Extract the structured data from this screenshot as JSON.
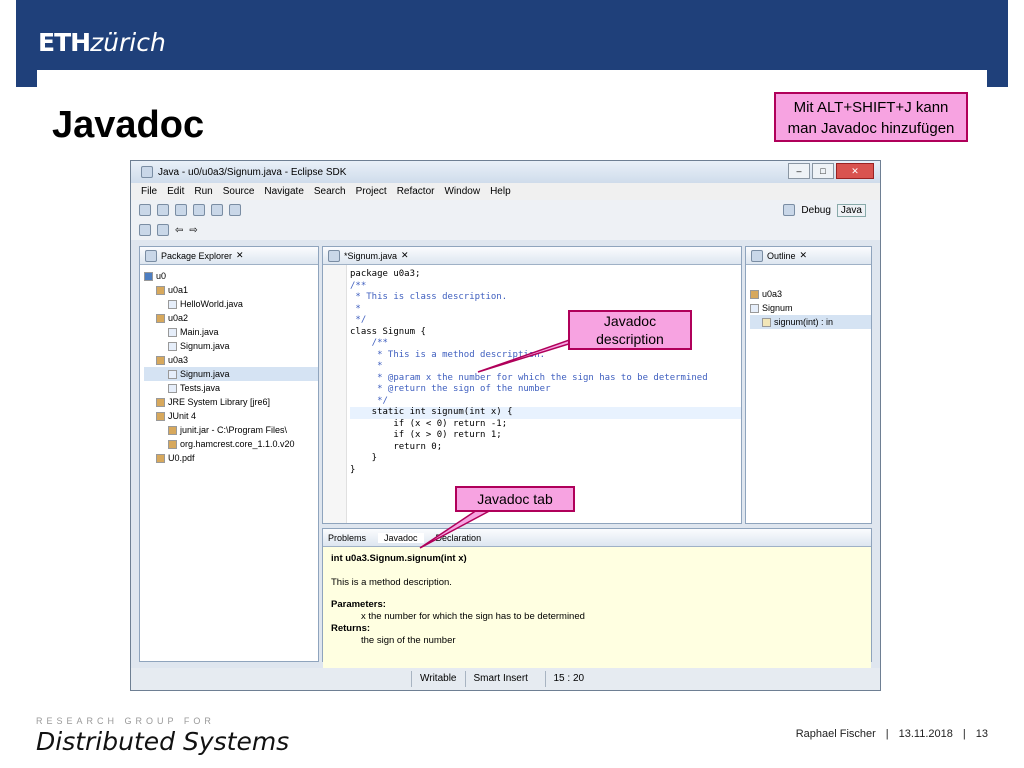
{
  "header": {
    "logo_bold": "ETH",
    "logo_italic": "zürich"
  },
  "slide": {
    "title": "Javadoc",
    "note_line1": "Mit ALT+SHIFT+J kann",
    "note_line2": "man Javadoc hinzufügen"
  },
  "window": {
    "title": "Java - u0/u0a3/Signum.java - Eclipse SDK",
    "buttons": [
      "–",
      "□",
      "✕"
    ]
  },
  "menu": [
    "File",
    "Edit",
    "Run",
    "Source",
    "Navigate",
    "Search",
    "Project",
    "Refactor",
    "Window",
    "Help"
  ],
  "toolbar": {
    "debug": "Debug",
    "java": "Java"
  },
  "explorer": {
    "tab": "Package Explorer",
    "items": [
      {
        "label": "u0",
        "indent": 0
      },
      {
        "label": "u0a1",
        "indent": 1
      },
      {
        "label": "HelloWorld.java",
        "indent": 2
      },
      {
        "label": "u0a2",
        "indent": 1
      },
      {
        "label": "Main.java",
        "indent": 2
      },
      {
        "label": "Signum.java",
        "indent": 2
      },
      {
        "label": "u0a3",
        "indent": 1
      },
      {
        "label": "Signum.java",
        "indent": 2
      },
      {
        "label": "Tests.java",
        "indent": 2
      },
      {
        "label": "JRE System Library [jre6]",
        "indent": 1
      },
      {
        "label": "JUnit 4",
        "indent": 1
      },
      {
        "label": "junit.jar - C:\\Program Files\\",
        "indent": 2
      },
      {
        "label": "org.hamcrest.core_1.1.0.v20",
        "indent": 2
      },
      {
        "label": "U0.pdf",
        "indent": 1
      }
    ]
  },
  "editor": {
    "tab": "*Signum.java",
    "lines": [
      "package u0a3;",
      "",
      "/**",
      " * This is class description.",
      " *",
      " */",
      "class Signum {",
      "",
      "    /**",
      "     * This is a method description.",
      "     *",
      "     * @param x the number for which the sign has to be determined",
      "     * @return the sign of the number",
      "     */",
      "    static int signum(int x) {",
      "        if (x < 0) return -1;",
      "        if (x > 0) return 1;",
      "        return 0;",
      "    }",
      "}"
    ]
  },
  "outline": {
    "tab": "Outline",
    "items": [
      "u0a3",
      "Signum",
      "signum(int) : in"
    ]
  },
  "bottom": {
    "tabs": [
      "Problems",
      "Javadoc",
      "Declaration"
    ],
    "signature": "int u0a3.Signum.signum(int x)",
    "description": "This is a method description.",
    "params_label": "Parameters:",
    "param": "x the number for which the sign has to be determined",
    "returns_label": "Returns:",
    "returns": "the sign of the number"
  },
  "status": {
    "writable": "Writable",
    "insert": "Smart Insert",
    "pos": "15 : 20"
  },
  "callouts": {
    "desc_line1": "Javadoc",
    "desc_line2": "description",
    "tab": "Javadoc tab"
  },
  "footer": {
    "group": "RESEARCH GROUP FOR",
    "brand": "Distributed Systems",
    "author": "Raphael Fischer",
    "date": "13.11.2018",
    "page": "13"
  }
}
